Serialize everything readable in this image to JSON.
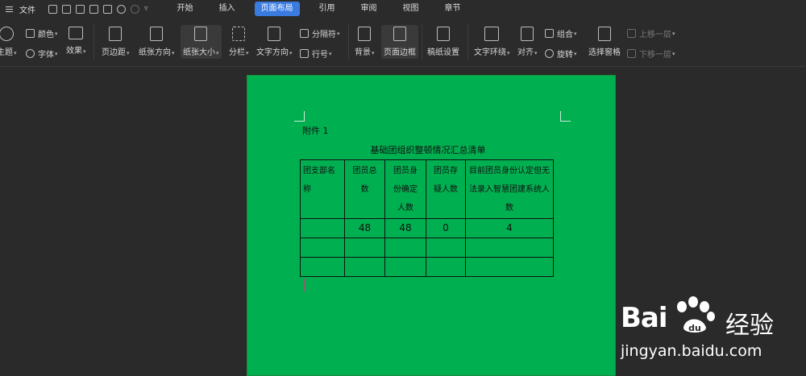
{
  "menubar": {
    "file_label": "文件",
    "quick_access_overflow": "▿",
    "tabs": [
      {
        "label": "开始",
        "active": false
      },
      {
        "label": "插入",
        "active": false
      },
      {
        "label": "页面布局",
        "active": true
      },
      {
        "label": "引用",
        "active": false
      },
      {
        "label": "审阅",
        "active": false
      },
      {
        "label": "视图",
        "active": false
      },
      {
        "label": "章节",
        "active": false
      }
    ]
  },
  "ribbon": {
    "theme": "主题",
    "color": "颜色",
    "font": "字体",
    "effect": "效果",
    "margins": "页边距",
    "orientation": "纸张方向",
    "size": "纸张大小",
    "columns": "分栏",
    "text_direction": "文字方向",
    "breaks": "分隔符",
    "line_numbers": "行号",
    "background": "背景",
    "page_border": "页面边框",
    "manuscript": "稿纸设置",
    "wrap_text": "文字环绕",
    "align": "对齐",
    "group": "组合",
    "rotate": "旋转",
    "selection_pane": "选择窗格",
    "bring_forward": "上移一层",
    "send_backward": "下移一层"
  },
  "document": {
    "attachment_label": "附件 1",
    "title": "基础团组织整顿情况汇总清单",
    "table": {
      "headers": [
        "团支部名称",
        "团员总数",
        "团员身份确定人数",
        "团员存疑人数",
        "目前团员身份认定但无法录入智慧团建系统人数"
      ],
      "rows": [
        [
          "",
          "48",
          "48",
          "0",
          "4"
        ],
        [
          "",
          "",
          "",
          "",
          ""
        ],
        [
          "",
          "",
          "",
          "",
          ""
        ]
      ]
    }
  },
  "watermark": {
    "brand_left": "Bai",
    "brand_right": "经验",
    "url": "jingyan.baidu.com"
  },
  "colors": {
    "page_background": "#00b050",
    "active_tab": "#3a7be0",
    "app_background": "#2a2a2a"
  }
}
